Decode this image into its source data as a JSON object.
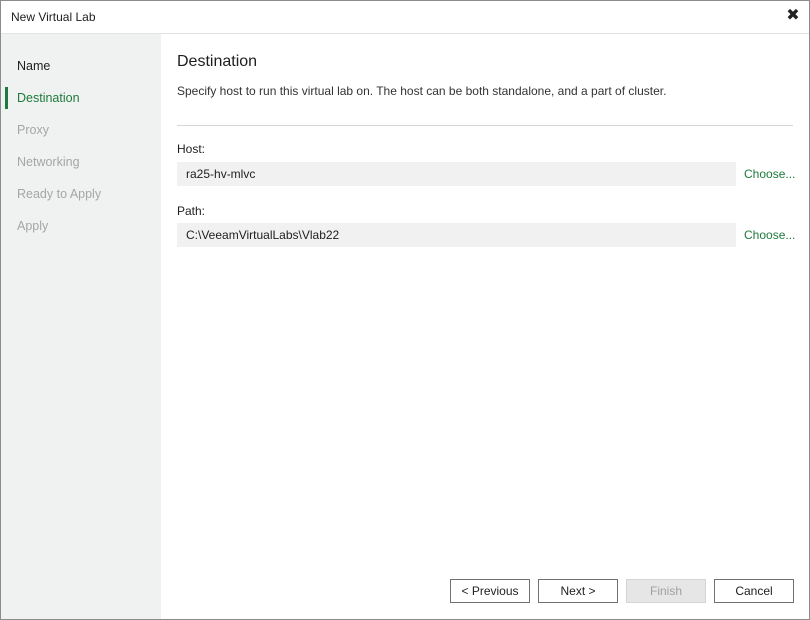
{
  "window": {
    "title": "New Virtual Lab",
    "close_glyph": "✖"
  },
  "sidebar": {
    "steps": [
      {
        "label": "Name",
        "state": "done"
      },
      {
        "label": "Destination",
        "state": "active"
      },
      {
        "label": "Proxy",
        "state": "pending"
      },
      {
        "label": "Networking",
        "state": "pending"
      },
      {
        "label": "Ready to Apply",
        "state": "pending"
      },
      {
        "label": "Apply",
        "state": "pending"
      }
    ]
  },
  "main": {
    "title": "Destination",
    "description": "Specify host to run this virtual lab on. The host can be both standalone, and a part of cluster.",
    "host": {
      "label": "Host:",
      "value": "ra25-hv-mlvc",
      "choose_label": "Choose..."
    },
    "path": {
      "label": "Path:",
      "value": "C:\\VeeamVirtualLabs\\Vlab22",
      "choose_label": "Choose..."
    }
  },
  "footer": {
    "previous_label": "< Previous",
    "next_label": "Next >",
    "finish_label": "Finish",
    "cancel_label": "Cancel"
  },
  "colors": {
    "accent": "#1e7a3c",
    "sidebar_bg": "#f0f2f1",
    "field_bg": "#f1f1f1",
    "disabled_text": "#a5a5a5"
  }
}
